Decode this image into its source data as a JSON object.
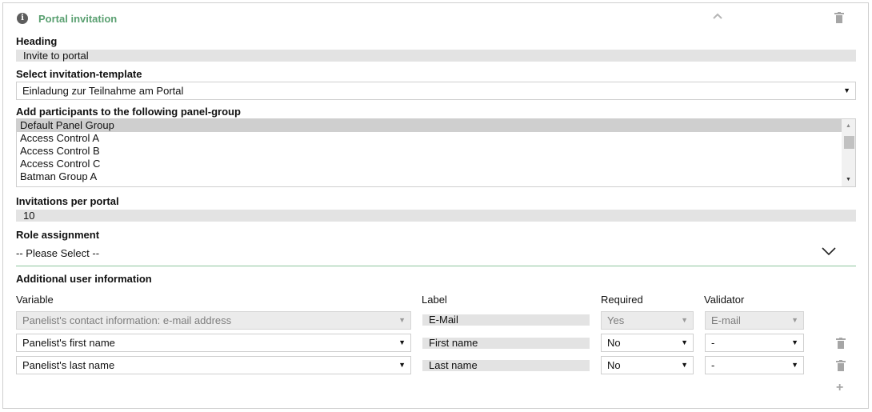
{
  "header": {
    "title": "Portal invitation",
    "info_icon": "i"
  },
  "heading": {
    "label": "Heading",
    "value": "Invite to portal"
  },
  "template": {
    "label": "Select invitation-template",
    "value": "Einladung zur Teilnahme am Portal"
  },
  "panel_group": {
    "label": "Add participants to the following panel-group",
    "options": [
      "Default Panel Group",
      "Access Control A",
      "Access Control B",
      "Access Control C",
      "Batman Group A"
    ],
    "selected": "Default Panel Group"
  },
  "invitations": {
    "label": "Invitations per portal",
    "value": "10"
  },
  "role": {
    "label": "Role assignment",
    "value": "-- Please Select --"
  },
  "additional": {
    "label": "Additional user information",
    "columns": {
      "variable": "Variable",
      "label": "Label",
      "required": "Required",
      "validator": "Validator"
    },
    "rows": [
      {
        "variable": "Panelist's contact information: e-mail address",
        "label": "E-Mail",
        "required": "Yes",
        "validator": "E-mail",
        "disabled": true
      },
      {
        "variable": "Panelist's first name",
        "label": "First name",
        "required": "No",
        "validator": "-",
        "disabled": false
      },
      {
        "variable": "Panelist's last name",
        "label": "Last name",
        "required": "No",
        "validator": "-",
        "disabled": false
      }
    ]
  },
  "colors": {
    "accent": "#5aa071",
    "divider": "#8bc59b",
    "readonly_bg": "#e3e3e3"
  },
  "icons": [
    "info-icon",
    "collapse-chevron-up-icon",
    "trash-icon",
    "chevron-down-icon",
    "plus-icon"
  ]
}
